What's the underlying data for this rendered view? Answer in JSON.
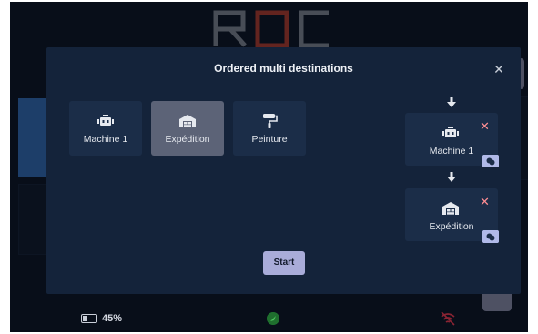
{
  "app": {
    "logo_text": "ROC",
    "colors": {
      "background": "#0c1523",
      "modal": "#14233a",
      "tile": "#1b2d48",
      "tile_selected": "#5c6377",
      "accent": "#a9acd9",
      "remove": "#ff8e93",
      "logo_accent": "#d6452f"
    }
  },
  "modal": {
    "title": "Ordered multi destinations",
    "close_icon": "close-icon",
    "destinations": [
      {
        "label": "Machine 1",
        "icon": "machine-icon",
        "selected": false
      },
      {
        "label": "Expédition",
        "icon": "warehouse-icon",
        "selected": true
      },
      {
        "label": "Peinture",
        "icon": "paint-roller-icon",
        "selected": false
      }
    ],
    "ordered": [
      {
        "label": "Machine 1",
        "icon": "machine-icon",
        "remove_icon": "remove-icon",
        "badge_icon": "link-icon"
      },
      {
        "label": "Expédition",
        "icon": "warehouse-icon",
        "remove_icon": "remove-icon",
        "badge_icon": "link-icon"
      }
    ],
    "start_label": "Start"
  },
  "status": {
    "battery": "45%"
  }
}
